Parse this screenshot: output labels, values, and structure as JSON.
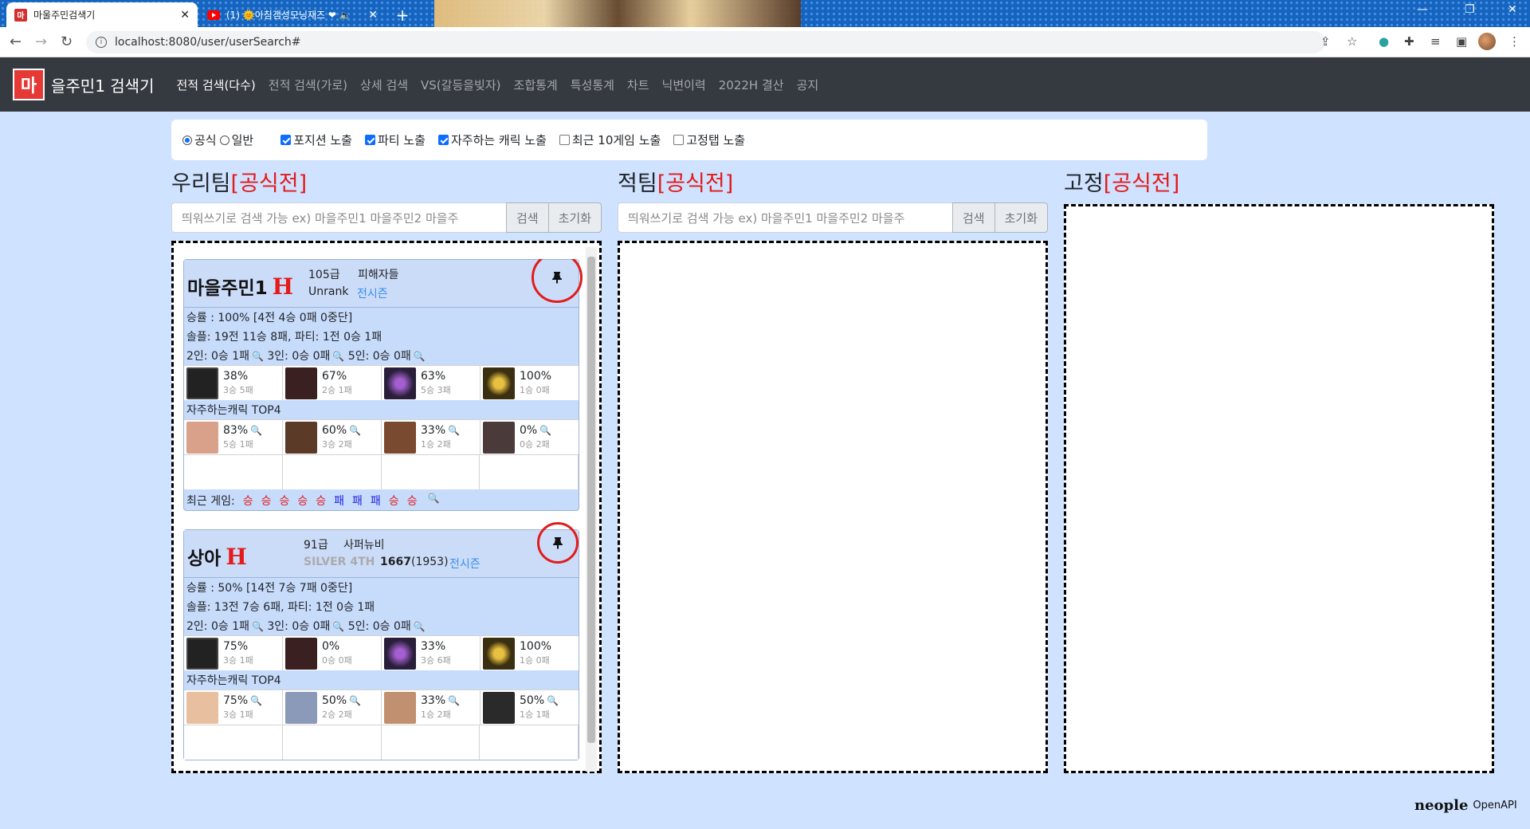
{
  "browser": {
    "tabs": [
      {
        "title": "마울주민검색기",
        "favicon": "마"
      },
      {
        "title": "(1) 🌞아침갬성모닝재즈 ❤ 🔈"
      }
    ],
    "url": "localhost:8080/user/userSearch#"
  },
  "site": {
    "brand_logo": "마",
    "brand_text": "을주민1 검색기",
    "nav": [
      "전적 검색(다수)",
      "전적 검색(가로)",
      "상세 검색",
      "VS(갈등을빚자)",
      "조합통계",
      "특성통계",
      "차트",
      "닉변이력",
      "2022H 결산",
      "공지"
    ]
  },
  "options": {
    "radio": [
      {
        "label": "공식",
        "checked": true
      },
      {
        "label": "일반",
        "checked": false
      }
    ],
    "checks": [
      {
        "label": "포지션 노출",
        "checked": true
      },
      {
        "label": "파티 노출",
        "checked": true
      },
      {
        "label": "자주하는 캐릭 노출",
        "checked": true
      },
      {
        "label": "최근 10게임 노출",
        "checked": false
      },
      {
        "label": "고정탭 노출",
        "checked": false
      }
    ]
  },
  "columns": [
    {
      "title": "우리팀",
      "tag": "[공식전]"
    },
    {
      "title": "적팀",
      "tag": "[공식전]"
    },
    {
      "title": "고정",
      "tag": "[공식전]"
    }
  ],
  "search": {
    "placeholder": "띄워쓰기로 검색 가능 ex) 마을주민1 마을주민2 마을주",
    "search_btn": "검색",
    "reset_btn": "초기화"
  },
  "cards": [
    {
      "name": "마을주민1",
      "hmark": "H",
      "grade": "105급",
      "guild": "피해자들",
      "rank": "Unrank",
      "season": "전시즌",
      "winrate": "승률 : 100% [4전 4승 0패 0중단]",
      "solo": "솔플: 19전 11승 8패, 파티: 1전 0승 1패",
      "party_2": "2인: 0승 1패",
      "party_3": "3인: 0승 0패",
      "party_5": "5인: 0승 0패",
      "positions": [
        {
          "icon": "tank-shield-icon",
          "pct": "38%",
          "wl": "3승 5패",
          "color": "#2a2a2a"
        },
        {
          "icon": "fist-icon",
          "pct": "67%",
          "wl": "2승 1패",
          "color": "#3a2020"
        },
        {
          "icon": "target-icon",
          "pct": "63%",
          "wl": "5승 3패",
          "color": "#2a1f3a"
        },
        {
          "icon": "star-icon",
          "pct": "100%",
          "wl": "1승 0패",
          "color": "#3a2f10"
        }
      ],
      "top_label": "자주하는캐릭 TOP4",
      "chars": [
        {
          "icon": "character-portrait-icon",
          "pct": "83%",
          "wl": "5승 1패",
          "color": "#d9a08a"
        },
        {
          "icon": "character-portrait-icon",
          "pct": "60%",
          "wl": "3승 2패",
          "color": "#5b3a28"
        },
        {
          "icon": "character-portrait-icon",
          "pct": "33%",
          "wl": "1승 2패",
          "color": "#7a4a30"
        },
        {
          "icon": "character-portrait-icon",
          "pct": "0%",
          "wl": "0승 2패",
          "color": "#4a3a3a"
        }
      ],
      "recent_label": "최근 게임:",
      "recent": [
        "승",
        "승",
        "승",
        "승",
        "승",
        "패",
        "패",
        "패",
        "승",
        "승"
      ]
    },
    {
      "name": "상아",
      "hmark": "H",
      "grade": "91급",
      "guild": "사퍼뉴비",
      "tier": "SILVER 4TH",
      "rp": "1667",
      "rp_max": "(1953)",
      "season": "전시즌",
      "winrate": "승률 : 50% [14전 7승 7패 0중단]",
      "solo": "솔플: 13전 7승 6패, 파티: 1전 0승 1패",
      "party_2": "2인: 0승 1패",
      "party_3": "3인: 0승 0패",
      "party_5": "5인: 0승 0패",
      "positions": [
        {
          "icon": "tank-shield-icon",
          "pct": "75%",
          "wl": "3승 1패",
          "color": "#2a2a2a"
        },
        {
          "icon": "fist-icon",
          "pct": "0%",
          "wl": "0승 0패",
          "color": "#3a2020"
        },
        {
          "icon": "target-icon",
          "pct": "33%",
          "wl": "3승 6패",
          "color": "#2a1f3a"
        },
        {
          "icon": "star-icon",
          "pct": "100%",
          "wl": "1승 0패",
          "color": "#3a2f10"
        }
      ],
      "top_label": "자주하는캐릭 TOP4",
      "chars": [
        {
          "icon": "character-portrait-icon",
          "pct": "75%",
          "wl": "3승 1패",
          "color": "#e8c0a0"
        },
        {
          "icon": "character-portrait-icon",
          "pct": "50%",
          "wl": "2승 2패",
          "color": "#8a9ab8"
        },
        {
          "icon": "character-portrait-icon",
          "pct": "33%",
          "wl": "1승 2패",
          "color": "#c09070"
        },
        {
          "icon": "character-portrait-icon",
          "pct": "50%",
          "wl": "1승 1패",
          "color": "#2a2a2a"
        }
      ]
    }
  ],
  "footer": {
    "neople": "neople",
    "openapi": "OpenAPI"
  }
}
